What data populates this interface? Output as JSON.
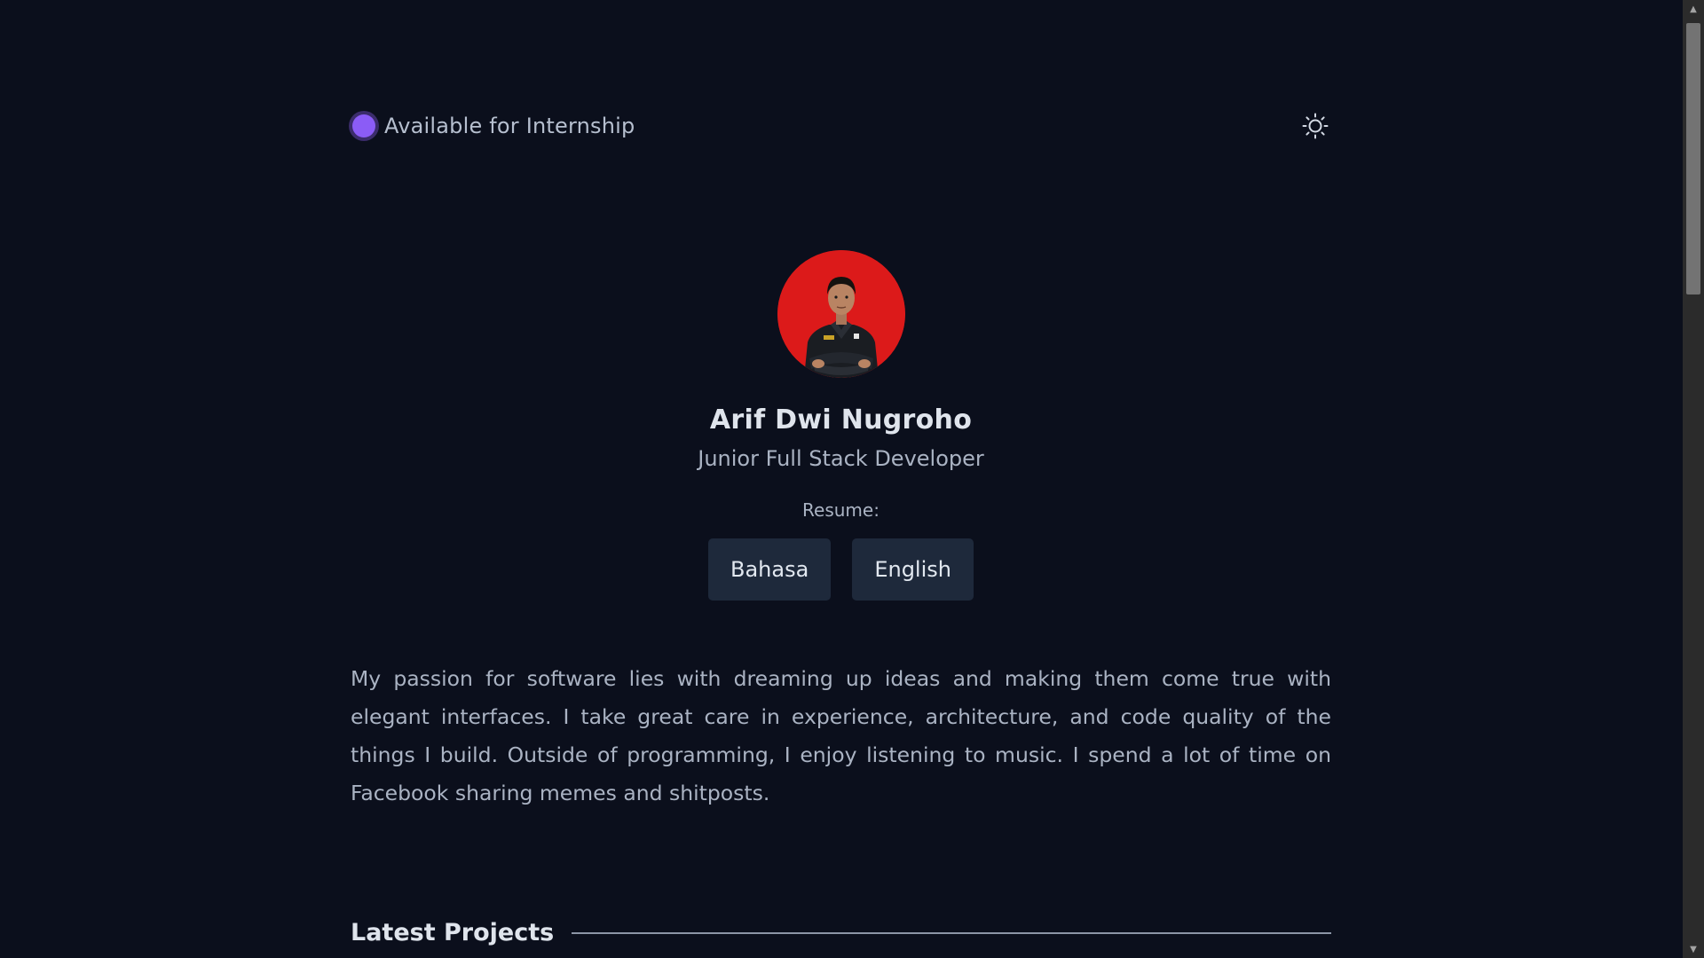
{
  "status": {
    "label": "Available for Internship",
    "dot_color": "#8b5cf6",
    "icon": "status-dot-icon"
  },
  "theme_toggle": {
    "icon": "sun-icon"
  },
  "profile": {
    "name": "Arif Dwi Nugroho",
    "role": "Junior Full Stack Developer",
    "avatar_bg": "#dc1a1a"
  },
  "resume": {
    "label": "Resume:",
    "buttons": [
      {
        "label": "Bahasa"
      },
      {
        "label": "English"
      }
    ]
  },
  "bio": {
    "text": "My passion for software lies with dreaming up ideas and making them come true with elegant interfaces. I take great care in experience, architecture, and code quality of the things I build. Outside of programming, I enjoy listening to music. I spend a lot of time on Facebook sharing memes and shitposts."
  },
  "projects": {
    "title": "Latest Projects"
  },
  "colors": {
    "background": "#0b0f1c",
    "button_bg": "#1e293b",
    "accent": "#8b5cf6"
  }
}
